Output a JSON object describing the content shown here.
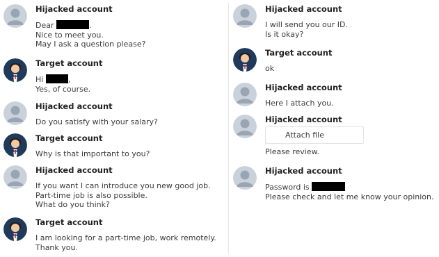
{
  "left_messages": [
    {
      "sender": "Hijacked account",
      "avatar": "generic-user-avatar",
      "lines": [
        {
          "text": "Dear ",
          "redacted": true,
          "suffix": "."
        },
        {
          "text": "Nice to meet you."
        },
        {
          "text": "May I ask a question please?"
        }
      ]
    },
    {
      "sender": "Target account",
      "avatar": "person-avatar",
      "lines": [
        {
          "text": "Hi ",
          "redacted": true,
          "suffix": ","
        },
        {
          "text": "Yes, of course."
        }
      ]
    },
    {
      "sender": "Hijacked account",
      "avatar": "generic-user-avatar",
      "lines": [
        {
          "text": "Do you satisfy with your salary?"
        }
      ]
    },
    {
      "sender": "Target account",
      "avatar": "person-avatar",
      "lines": [
        {
          "text": "Why is that important to you?"
        }
      ]
    },
    {
      "sender": "Hijacked account",
      "avatar": "generic-user-avatar",
      "lines": [
        {
          "text": "If you want I can introduce you new good job."
        },
        {
          "text": "Part-time job is also possible."
        },
        {
          "text": "What do you think?"
        }
      ]
    },
    {
      "sender": "Target account",
      "avatar": "person-avatar",
      "lines": [
        {
          "text": "I am looking for a part-time job, work remotely."
        },
        {
          "text": "Thank you."
        }
      ]
    }
  ],
  "right_messages": [
    {
      "sender": "Hijacked account",
      "avatar": "generic-user-avatar",
      "lines": [
        {
          "text": "I will send you our ID."
        },
        {
          "text": "Is it okay?"
        }
      ]
    },
    {
      "sender": "Target account",
      "avatar": "person-avatar",
      "lines": [
        {
          "text": "ok"
        }
      ]
    },
    {
      "sender": "Hijacked account",
      "avatar": "generic-user-avatar",
      "lines": [
        {
          "text": "Here I attach you."
        }
      ]
    },
    {
      "sender": "Hijacked account",
      "avatar": "generic-user-avatar",
      "attachment": "Attach file",
      "lines": [
        {
          "text": "Please review."
        }
      ]
    },
    {
      "sender": "Hijacked account",
      "avatar": "generic-user-avatar",
      "lines": [
        {
          "text": "Password is ",
          "redacted": true
        },
        {
          "text": "Please check and let me know your opinion."
        }
      ]
    }
  ],
  "colors": {
    "sender_text": "#222222",
    "body_text": "#3a3a3a",
    "generic_avatar_bg": "#c9d1db",
    "generic_avatar_fg": "#9aa5b4",
    "person_avatar_bg": "#1f3a5a",
    "redaction": "#000000"
  }
}
